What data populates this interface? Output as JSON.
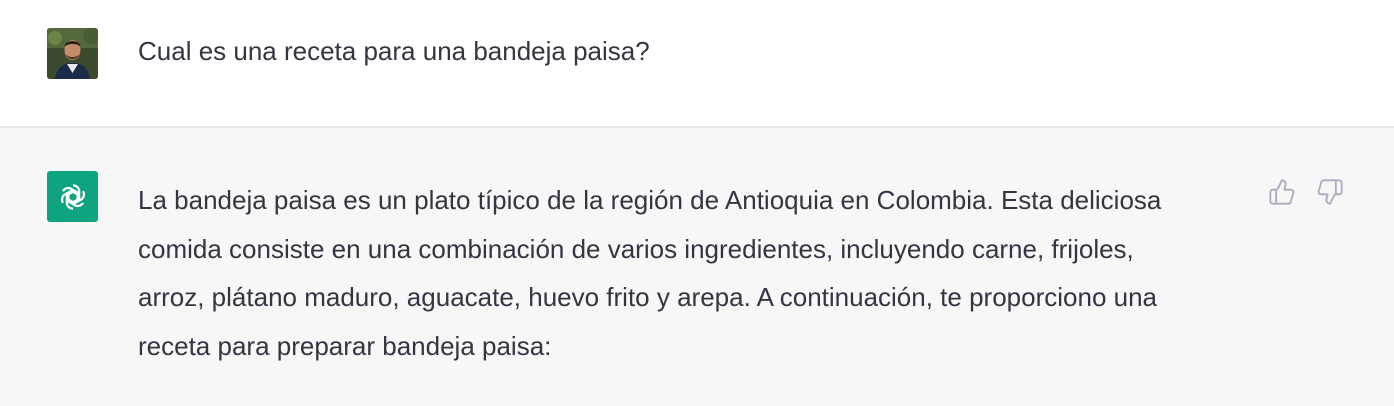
{
  "user_message": {
    "avatar_icon": "user-photo-avatar",
    "text": "Cual es una receta para una bandeja paisa?"
  },
  "assistant_message": {
    "avatar_icon": "openai-logo-icon",
    "avatar_color": "#10a37f",
    "lines": [
      "La bandeja paisa es un plato típico de la región de Antioquia en Colombia. Esta deliciosa",
      "comida consiste en una combinación de varios ingredientes, incluyendo carne, frijoles,",
      "arroz, plátano maduro, aguacate, huevo frito y arepa. A continuación, te proporciono una",
      "receta para preparar bandeja paisa:"
    ],
    "feedback": {
      "thumbs_up_icon": "thumbs-up-icon",
      "thumbs_down_icon": "thumbs-down-icon"
    }
  },
  "colors": {
    "user_bg": "#ffffff",
    "assistant_bg": "#f7f7f8",
    "text": "#343541",
    "icon_gray": "#acacbe"
  }
}
